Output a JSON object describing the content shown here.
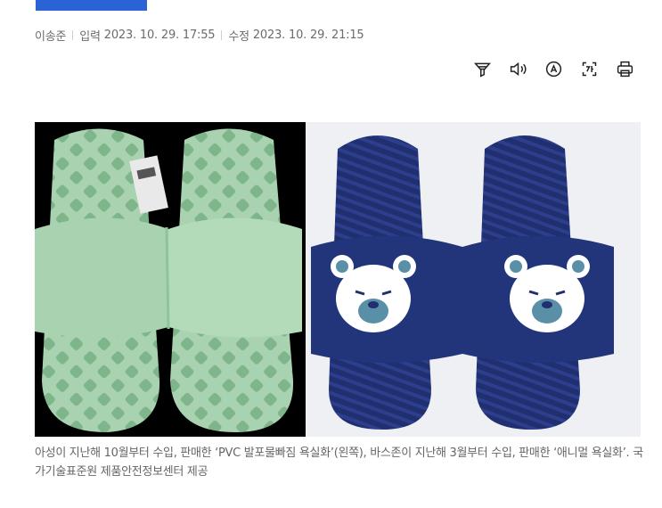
{
  "byline": {
    "author": "이송준",
    "input_label": "입력",
    "input_time": "2023. 10. 29. 17:55",
    "modified_label": "수정",
    "modified_time": "2023. 10. 29. 21:15"
  },
  "toolbar": {
    "items": [
      {
        "icon": "filter-icon"
      },
      {
        "icon": "speaker-icon"
      },
      {
        "icon": "font-size-icon"
      },
      {
        "icon": "translate-icon"
      },
      {
        "icon": "print-icon"
      }
    ]
  },
  "photo": {
    "colors": {
      "left_bg": "#000000",
      "left_slipper": "#a9d3b0",
      "right_bg": "#eef0f3",
      "right_slipper": "#1f2f70",
      "bear": "#ffffff",
      "bear_muzzle": "#5a8fa8"
    }
  },
  "caption": {
    "text": "아성이 지난해 10월부터 수입, 판매한 ‘PVC 발포물빠짐 욕실화’(왼쪽), 바스존이 지난해 3월부터 수입, 판매한 ‘애니멀 욕실화’. 국가기술표준원 제품안전정보센터 제공"
  }
}
